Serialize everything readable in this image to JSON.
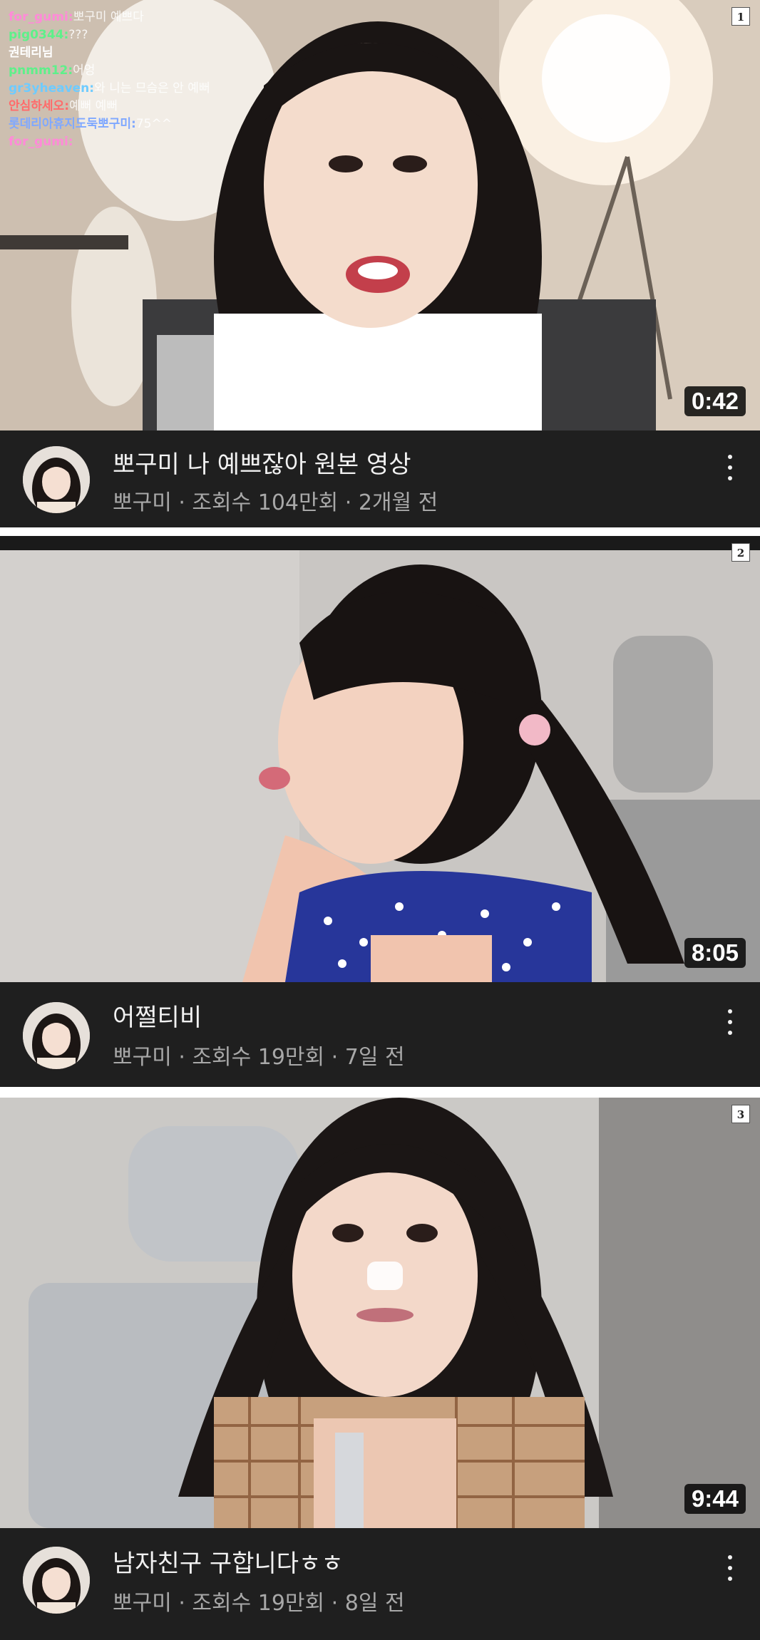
{
  "videos": [
    {
      "number": "1",
      "duration": "0:42",
      "title": "뽀구미 나 예쁘잖아 원본 영상",
      "channel": "뽀구미",
      "views": "조회수 104만회",
      "age": "2개월 전",
      "chat": [
        {
          "user": "for_gumi:",
          "msg": "뽀구미 예쁘다",
          "color": "#ff8ad8"
        },
        {
          "user": "pig0344:",
          "msg": "???",
          "color": "#5ef08a"
        },
        {
          "user": "권테리님",
          "msg": "",
          "color": "#ffffff"
        },
        {
          "user": "pnmm12:",
          "msg": "어엉",
          "color": "#5ef08a"
        },
        {
          "user": "gr3yheaven:",
          "msg": "와 니는 므슴은 안 예뻐",
          "color": "#6ecbff"
        },
        {
          "user": "안심하세오:",
          "msg": "예뻐 예뻐",
          "color": "#ff6b6b"
        },
        {
          "user": "롯데리아휴지도둑뽀구미:",
          "msg": "75^^",
          "color": "#7fa8ff"
        },
        {
          "user": "for_gumi:",
          "msg": "",
          "color": "#ff8ad8"
        }
      ]
    },
    {
      "number": "2",
      "duration": "8:05",
      "title": "어쩔티비",
      "channel": "뽀구미",
      "views": "조회수 19만회",
      "age": "7일 전"
    },
    {
      "number": "3",
      "duration": "9:44",
      "title": "남자친구 구합니다ㅎㅎ",
      "channel": "뽀구미",
      "views": "조회수 19만회",
      "age": "8일 전"
    }
  ],
  "separator": " · ",
  "icons": {
    "more": "more-vert-icon",
    "avatar": "channel-avatar"
  },
  "colors": {
    "meta_bg": "#1f1f1f",
    "title_text": "#f1f1f1",
    "sub_text": "#a8a8a8",
    "duration_bg": "#000000"
  }
}
